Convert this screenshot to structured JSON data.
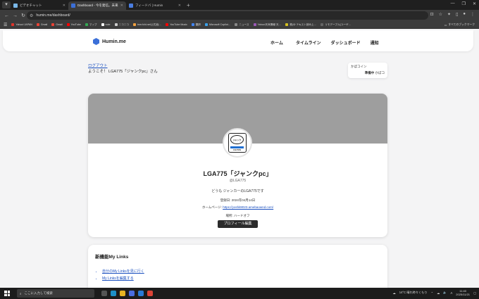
{
  "browser": {
    "tabs": [
      {
        "label": "ビデオチャット",
        "favicon_color": "#7ab8e8",
        "active": false
      },
      {
        "label": "Dashboard - 今を発信。未来を…",
        "favicon_color": "#3b6fd8",
        "active": true
      },
      {
        "label": "フィードバ | Humin",
        "favicon_color": "#4a7de0",
        "active": false
      }
    ],
    "url": "humin.me/dashboard/",
    "bookmarks": [
      {
        "label": "Yahoo! JAPAN",
        "color": "#e0342b"
      },
      {
        "label": "Gmail",
        "color": "#ea4335"
      },
      {
        "label": "Gmail",
        "color": "#ea4335"
      },
      {
        "label": "YouTube",
        "color": "#ff0000"
      },
      {
        "label": "マップ",
        "color": "#34a853"
      },
      {
        "label": "note",
        "color": "#ffffff"
      },
      {
        "label": "ニコニコ",
        "color": "#cccccc"
      },
      {
        "label": "tmrr.fchi.net公式(仮…",
        "color": "#f0a040"
      },
      {
        "label": "YouTube Music",
        "color": "#ff0000"
      },
      {
        "label": "翻訳",
        "color": "#4285f4"
      },
      {
        "label": "Microsoft Copilot…",
        "color": "#3aa0e8"
      },
      {
        "label": "ニュース",
        "color": "#888888"
      },
      {
        "label": "Yahoo!天気情報 天…",
        "color": "#9b59b6"
      },
      {
        "label": "株)ゆ テキスト読み上…",
        "color": "#d4c020"
      },
      {
        "label": "リモデーブル(ユーザ…",
        "color": "#666666"
      }
    ],
    "all_bookmarks": "すべてのブックマーク"
  },
  "site": {
    "logo": "Humin.me",
    "nav": [
      "ホーム",
      "タイムライン",
      "ダッシュボード",
      "通知"
    ]
  },
  "account": {
    "logout": "ログアウト",
    "welcome": "ようこそ！ LGA775「ジャンクpc」さん"
  },
  "coin": {
    "title": "かぼコイン",
    "status": "準備中",
    "unit": "かぼコ"
  },
  "profile": {
    "name": "LGA775「ジャンクpc」",
    "handle": "@LGA775",
    "bio": "どうも ジャンカーのLGA775です",
    "registered": "登録日: 2024年04月14日",
    "homepage_label": "ホームページ:",
    "homepage_url": "https://yoshit8023.amebaownd.com/",
    "location": "場所: ハードオフ",
    "edit_button": "プロフィール編集",
    "avatar_text_top": "ジャンク",
    "avatar_text_bottom": "CAUTION"
  },
  "links": {
    "title": "新機能My Links",
    "items": [
      "自分のMy Linksを見に行く",
      "My Linksを編集する"
    ]
  },
  "taskbar": {
    "search_placeholder": "ここに入力して検索",
    "weather": "14°C 晴れ時々くもり",
    "ime": "A",
    "time": "11:40",
    "date": "2025/11/21"
  }
}
